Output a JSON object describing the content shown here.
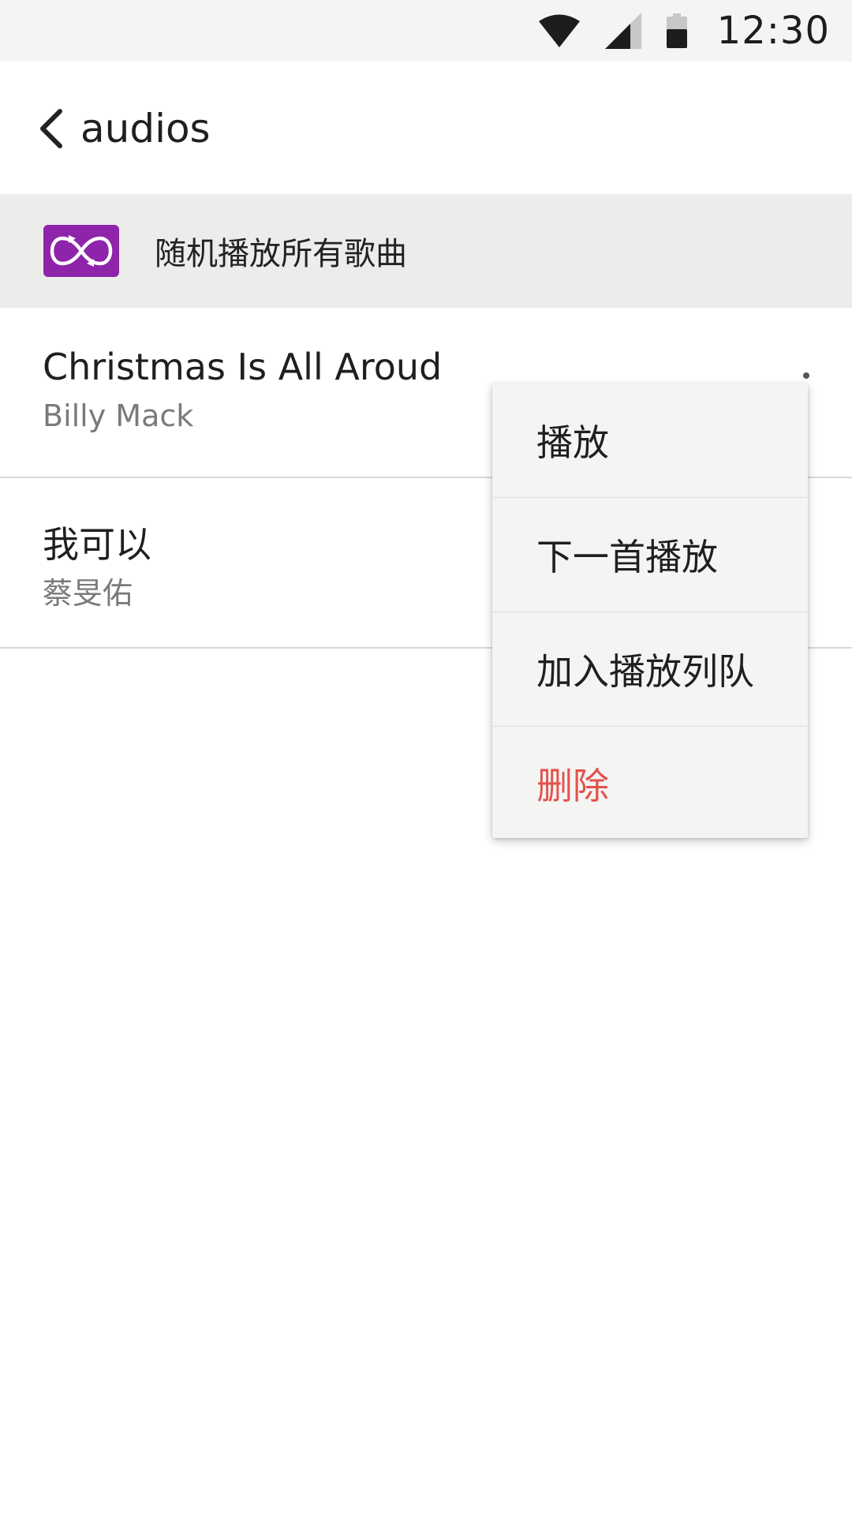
{
  "status_bar": {
    "time": "12:30",
    "icons": [
      "wifi-icon",
      "signal-icon",
      "battery-icon"
    ]
  },
  "header": {
    "back_icon": "chevron-left-icon",
    "title": "audios"
  },
  "shuffle": {
    "icon": "shuffle-infinity-icon",
    "icon_color": "#8e24aa",
    "label": "随机播放所有歌曲"
  },
  "songs": [
    {
      "title": "Christmas Is All Aroud",
      "artist": "Billy Mack"
    },
    {
      "title": "我可以",
      "artist": "蔡旻佑"
    }
  ],
  "context_menu": {
    "items": [
      {
        "label": "播放"
      },
      {
        "label": "下一首播放"
      },
      {
        "label": "加入播放列队"
      },
      {
        "label": "删除",
        "color": "#e2534d"
      }
    ]
  },
  "colors": {
    "status_bar_bg": "#f4f4f2",
    "shuffle_row_bg": "#ececeb",
    "menu_bg": "#f4f4f3",
    "danger": "#e2534d"
  }
}
